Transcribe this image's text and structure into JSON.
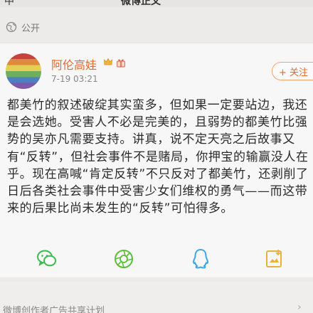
{
  "header": {
    "top_left": "中",
    "title": "微博正文"
  },
  "visibility": {
    "icon": "globe-icon",
    "label": "公开"
  },
  "post": {
    "author": "阿伦高娃",
    "timestamp": "7-19 03:21",
    "follow_label": "+ 关注",
    "accent_color": "#e8672a",
    "body": "都美竹的叙述破绽其实蛮多，但如果一定要站边，我还是会选她。受害人不必是完美的，且弱势的都美竹比强势的吴亦凡需要支持。讲真，说不定天亮之后故事又有“反转”，但社会事件不是赌局，你押宝的输赢没人在乎。现在高喊“肯定反转”不只反对了都美竹，还剥削了日后各类社会事件中受害少女们维权的勇气——而这带来的后果比尚未发生的“反转”可怕得多。"
  },
  "share": {
    "items": [
      {
        "icon": "wechat-icon",
        "color": "#3dbb4e"
      },
      {
        "icon": "moments-icon",
        "color": "#5bbf39"
      },
      {
        "icon": "qq-icon",
        "color": "#3aa6e8"
      },
      {
        "icon": "save-image-icon",
        "color": "#e9b23a"
      }
    ]
  },
  "footer": {
    "text": "微博创作者广告共享计划"
  }
}
